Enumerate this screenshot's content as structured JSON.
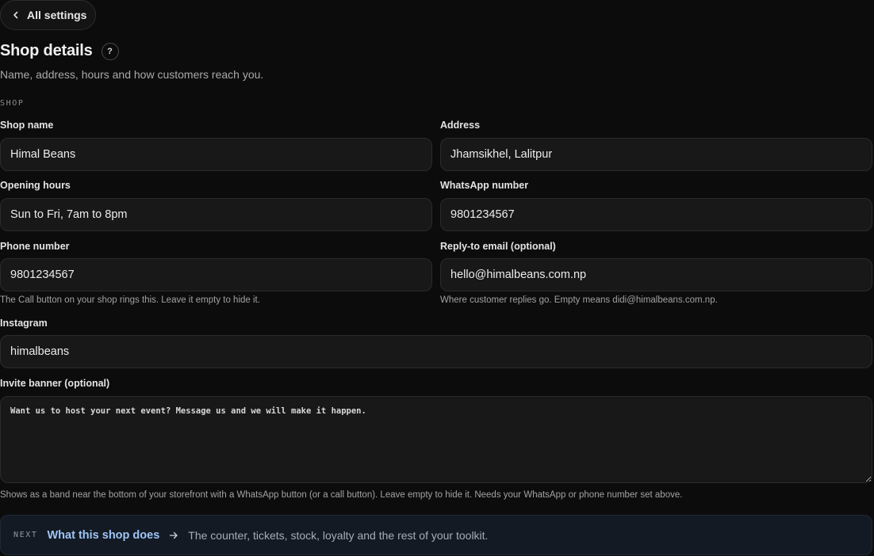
{
  "nav": {
    "back_label": "All settings"
  },
  "header": {
    "title": "Shop details",
    "help_glyph": "?",
    "subtitle": "Name, address, hours and how customers reach you."
  },
  "section": {
    "label": "SHOP"
  },
  "fields": {
    "shop_name": {
      "label": "Shop name",
      "value": "Himal Beans"
    },
    "address": {
      "label": "Address",
      "value": "Jhamsikhel, Lalitpur"
    },
    "opening_hours": {
      "label": "Opening hours",
      "value": "Sun to Fri, 7am to 8pm"
    },
    "whatsapp": {
      "label": "WhatsApp number",
      "value": "9801234567"
    },
    "phone": {
      "label": "Phone number",
      "value": "9801234567",
      "hint": "The Call button on your shop rings this. Leave it empty to hide it."
    },
    "reply_email": {
      "label": "Reply-to email (optional)",
      "value": "hello@himalbeans.com.np",
      "hint": "Where customer replies go. Empty means didi@himalbeans.com.np."
    },
    "instagram": {
      "label": "Instagram",
      "value": "himalbeans"
    },
    "invite_banner": {
      "label": "Invite banner (optional)",
      "value": "Want us to host your next event? Message us and we will make it happen.",
      "hint": "Shows as a band near the bottom of your storefront with a WhatsApp button (or a call button). Leave empty to hide it. Needs your WhatsApp or phone number set above."
    }
  },
  "next": {
    "tag": "NEXT",
    "title": "What this shop does",
    "description": "The counter, tickets, stock, loyalty and the rest of your toolkit."
  },
  "icons": {
    "back": "chevron-left-icon",
    "help": "question-icon",
    "next_arrow": "arrow-right-icon"
  },
  "colors": {
    "background": "#0c0c0c",
    "input_background": "#181818",
    "next_accent": "#9fc4f5",
    "next_background": "#131a24"
  }
}
